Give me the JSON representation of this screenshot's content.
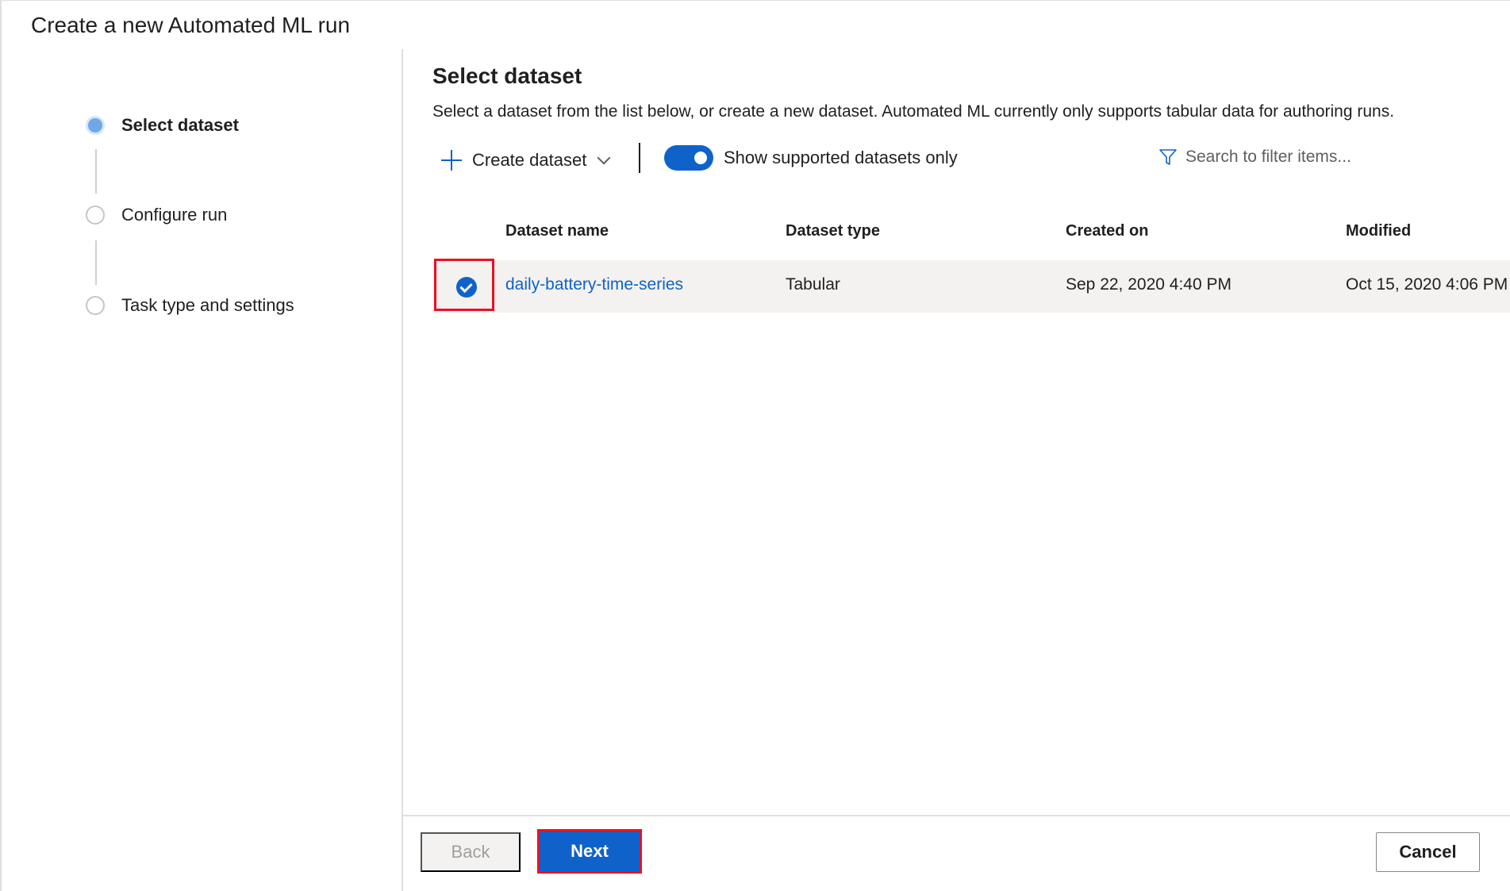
{
  "window": {
    "title": "Create a new Automated ML run"
  },
  "stepper": {
    "steps": [
      {
        "label": "Select dataset",
        "state": "active"
      },
      {
        "label": "Configure run",
        "state": "pending"
      },
      {
        "label": "Task type and settings",
        "state": "pending"
      }
    ]
  },
  "main": {
    "title": "Select dataset",
    "description": "Select a dataset from the list below, or create a new dataset. Automated ML currently only supports tabular data for authoring runs.",
    "toolbar": {
      "create_label": "Create dataset",
      "toggle_label": "Show supported datasets only",
      "toggle_on": true,
      "search_placeholder": "Search to filter items..."
    },
    "table": {
      "headers": [
        "Dataset name",
        "Dataset type",
        "Created on",
        "Modified"
      ],
      "rows": [
        {
          "selected": true,
          "name": "daily-battery-time-series",
          "type": "Tabular",
          "created": "Sep 22, 2020 4:40 PM",
          "modified": "Oct 15, 2020 4:06 PM"
        }
      ]
    }
  },
  "footer": {
    "back_label": "Back",
    "next_label": "Next",
    "cancel_label": "Cancel"
  },
  "colors": {
    "accent": "#0f62c9",
    "highlight_border": "#e81123",
    "row_selected_bg": "#f3f2f1"
  }
}
